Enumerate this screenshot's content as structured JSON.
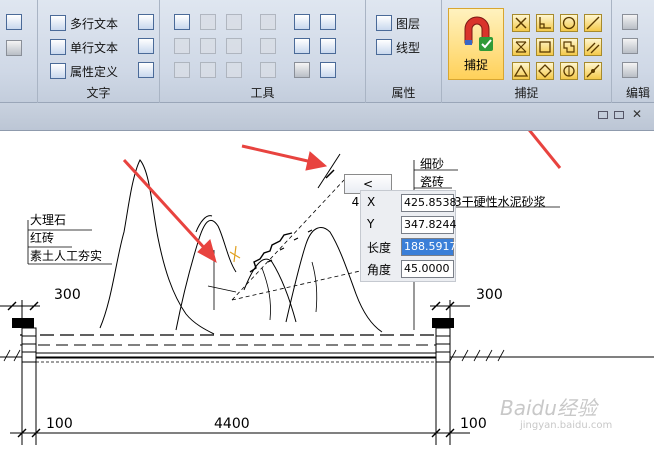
{
  "ribbon": {
    "groups": {
      "text": {
        "label": "文字",
        "items": [
          {
            "label": "多行文本",
            "icon": "multiline-text-icon"
          },
          {
            "label": "单行文本",
            "icon": "single-line-text-icon"
          },
          {
            "label": "属性定义",
            "icon": "attribute-definition-icon"
          }
        ]
      },
      "tools": {
        "label": "工具"
      },
      "properties": {
        "label": "属性",
        "items": [
          {
            "label": "图层",
            "icon": "layers-icon"
          },
          {
            "label": "线型",
            "icon": "linetype-icon"
          }
        ]
      },
      "snap": {
        "label": "捕捉",
        "button_label": "捕捉"
      },
      "edit": {
        "label": "编辑"
      }
    },
    "accent_color": "#ffd15a"
  },
  "drawing": {
    "material_labels_left": [
      "大理石",
      "红砖",
      "素土人工夯实"
    ],
    "material_labels_right_top": [
      "细砂",
      "瓷砖"
    ],
    "material_label_right": "3干硬性水泥砂浆",
    "dimensions": {
      "left_top": "300",
      "right_top": "300",
      "left_bottom": "100",
      "center_bottom": "4400",
      "right_bottom": "100"
    },
    "tooltip": "< 45.0°"
  },
  "coord_panel": {
    "rows": [
      {
        "label": "X",
        "value": "425.8538"
      },
      {
        "label": "Y",
        "value": "347.8244"
      },
      {
        "label": "长度",
        "value": "188.5917",
        "selected": true
      },
      {
        "label": "角度",
        "value": "45.0000"
      }
    ]
  },
  "watermark": {
    "text": "Baidu经验",
    "sub": "jingyan.baidu.com"
  },
  "annotation_color": "#e8433f"
}
